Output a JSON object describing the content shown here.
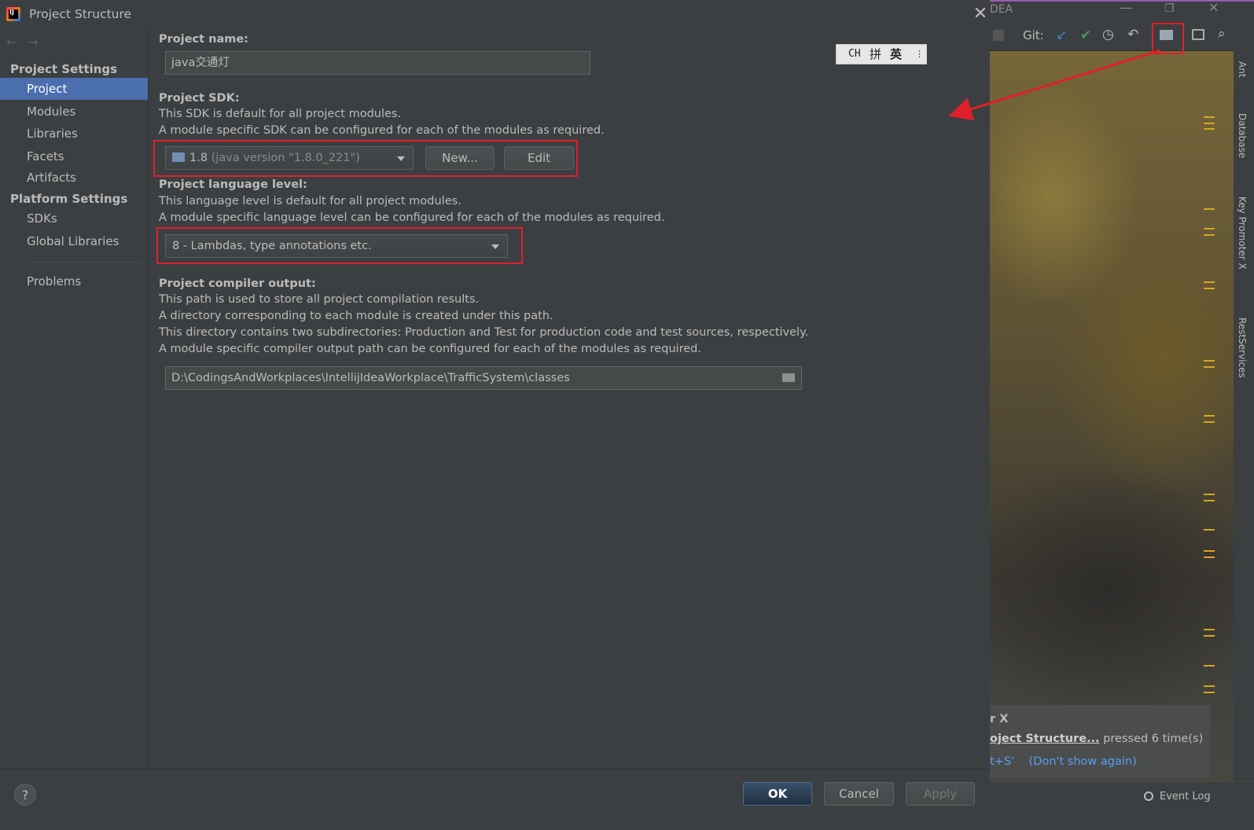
{
  "dialog": {
    "title": "Project Structure",
    "close_icon": "close-icon"
  },
  "sidebar": {
    "project_settings_header": "Project Settings",
    "items_project_settings": [
      "Project",
      "Modules",
      "Libraries",
      "Facets",
      "Artifacts"
    ],
    "platform_settings_header": "Platform Settings",
    "items_platform_settings": [
      "SDKs",
      "Global Libraries"
    ],
    "problems": "Problems",
    "selected": "Project"
  },
  "main": {
    "project_name_label": "Project name:",
    "project_name_value": "java交通灯",
    "sdk_label": "Project SDK:",
    "sdk_desc1": "This SDK is default for all project modules.",
    "sdk_desc2": "A module specific SDK can be configured for each of the modules as required.",
    "sdk_version": "1.8",
    "sdk_version_detail": "(java version \"1.8.0_221\")",
    "sdk_new_button": "New...",
    "sdk_edit_button": "Edit",
    "lang_label": "Project language level:",
    "lang_desc1": "This language level is default for all project modules.",
    "lang_desc2": "A module specific language level can be configured for each of the modules as required.",
    "lang_value": "8 - Lambdas, type annotations etc.",
    "output_label": "Project compiler output:",
    "output_desc1": "This path is used to store all project compilation results.",
    "output_desc2": "A directory corresponding to each module is created under this path.",
    "output_desc3": "This directory contains two subdirectories: Production and Test for production code and test sources, respectively.",
    "output_desc4": "A module specific compiler output path can be configured for each of the modules as required.",
    "output_path": "D:\\CodingsAndWorkplaces\\IntellijIdeaWorkplace\\TrafficSystem\\classes"
  },
  "ime": {
    "ch": "CH",
    "pin": "拼",
    "ying": "英"
  },
  "footer": {
    "help": "?",
    "ok": "OK",
    "cancel": "Cancel",
    "apply": "Apply"
  },
  "ide_background": {
    "title_fragment": "DEA",
    "git_label": "Git:",
    "side_tabs": [
      "Ant",
      "Database",
      "Key Promoter X",
      "RestServices"
    ],
    "notification_title": "r X",
    "notification_link": "oject Structure...",
    "notification_text": "pressed 6 time(s)",
    "notification_shortcut": "t+S'",
    "notification_dont_show": "(Don't show again)",
    "event_log": "Event Log"
  },
  "colors": {
    "accent_selected": "#4b6eaf",
    "highlight_red": "#e0202a",
    "link_blue": "#589df6"
  }
}
